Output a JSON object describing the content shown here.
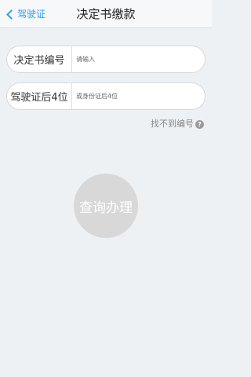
{
  "nav": {
    "back_label": "驾驶证",
    "title": "决定书缴款"
  },
  "form": {
    "decision_no": {
      "label": "决定书编号",
      "placeholder": "请输入",
      "value": ""
    },
    "license_last4": {
      "label": "驾驶证后4位",
      "placeholder": "或身份证后4位",
      "value": ""
    }
  },
  "help": {
    "label": "找不到编号",
    "icon": "question-icon",
    "icon_glyph": "?"
  },
  "action": {
    "label": "查询办理"
  },
  "colors": {
    "accent": "#2fa0e6",
    "background": "#eef1f4",
    "button": "#d8d8d8"
  }
}
